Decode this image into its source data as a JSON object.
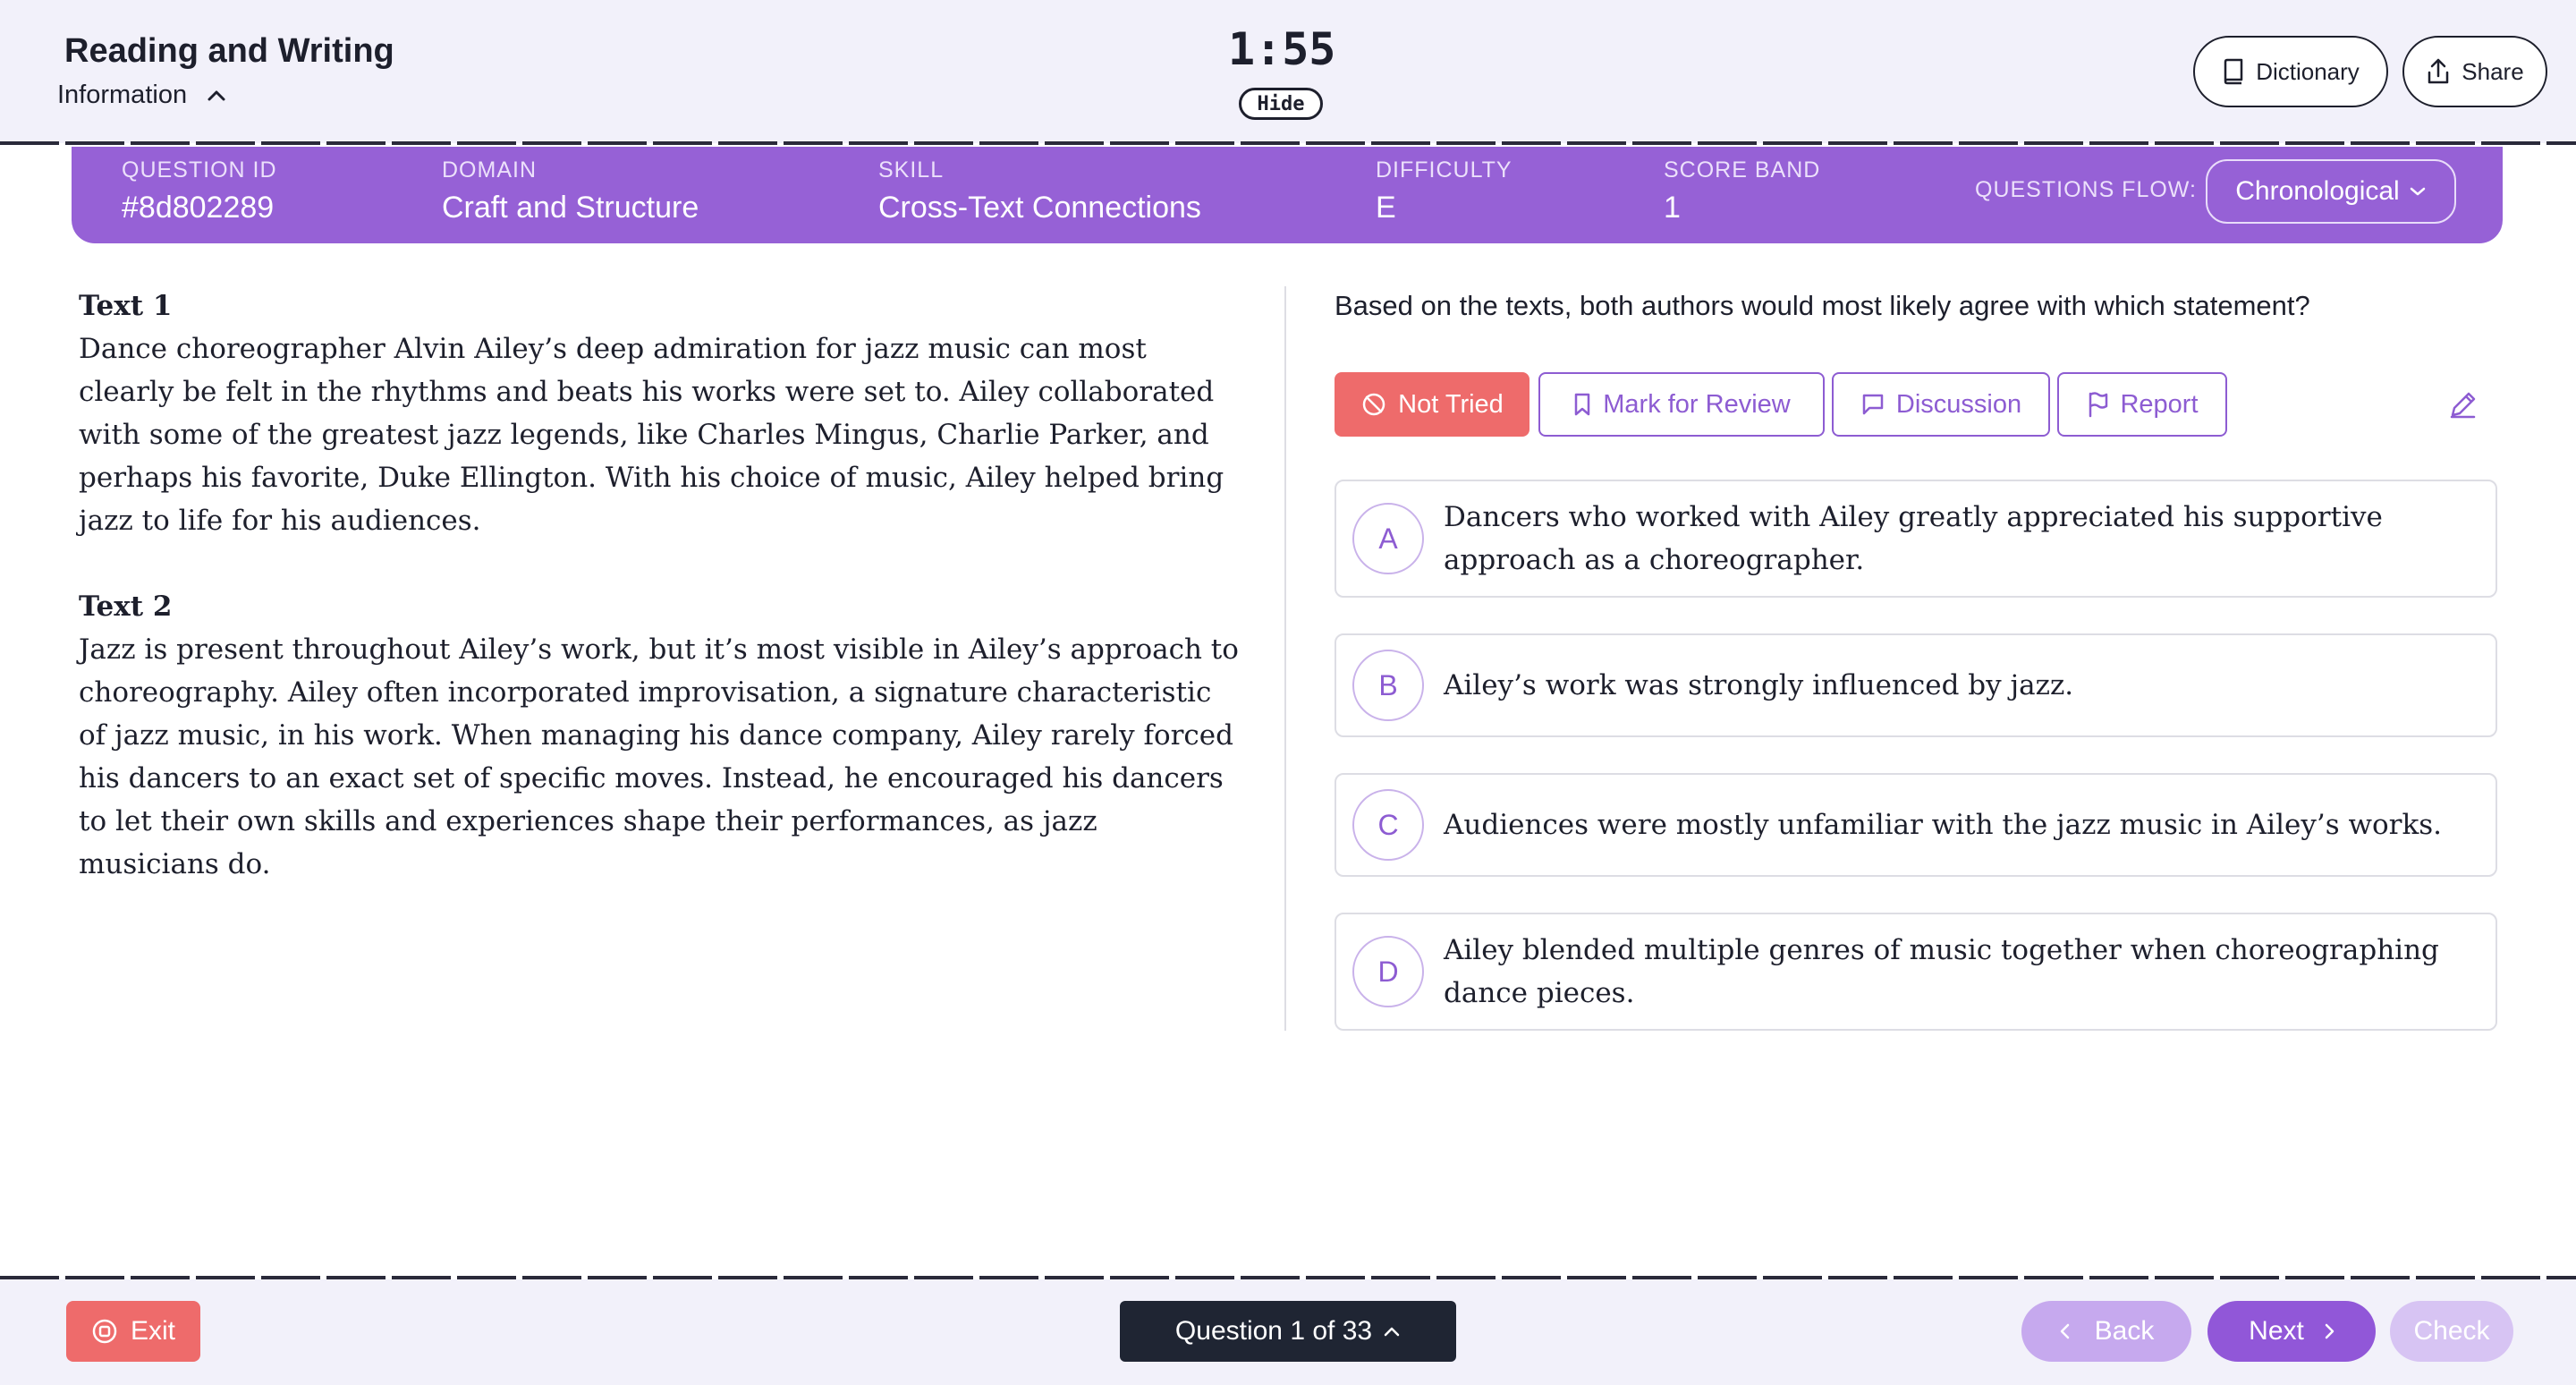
{
  "header": {
    "title": "Reading and Writing",
    "info_label": "Information",
    "timer": "1:55",
    "hide_label": "Hide",
    "dictionary_label": "Dictionary",
    "share_label": "Share"
  },
  "info_bar": {
    "question_id": {
      "label": "QUESTION ID",
      "value": "#8d802289"
    },
    "domain": {
      "label": "DOMAIN",
      "value": "Craft and Structure"
    },
    "skill": {
      "label": "SKILL",
      "value": "Cross-Text Connections"
    },
    "difficulty": {
      "label": "DIFFICULTY",
      "value": "E"
    },
    "score_band": {
      "label": "SCORE BAND",
      "value": "1"
    },
    "questions_flow": {
      "label": "QUESTIONS FLOW:",
      "value": "Chronological"
    }
  },
  "passage": {
    "text1_title": "Text 1",
    "text1_body": "Dance choreographer Alvin Ailey’s deep admiration for jazz music can most clearly be felt in the rhythms and beats his works were set to. Ailey collaborated with some of the greatest jazz legends, like Charles Mingus, Charlie Parker, and perhaps his favorite, Duke Ellington. With his choice of music, Ailey helped bring jazz to life for his audiences.",
    "text2_title": "Text 2",
    "text2_body": "Jazz is present throughout Ailey’s work, but it’s most visible in Ailey’s approach to choreography. Ailey often incorporated improvisation, a signature characteristic of jazz music, in his work. When managing his dance company, Ailey rarely forced his dancers to an exact set of specific moves. Instead, he encouraged his dancers to let their own skills and experiences shape their performances, as jazz musicians do."
  },
  "question": {
    "prompt": "Based on the texts, both authors would most likely agree with which statement?",
    "actions": {
      "not_tried": "Not Tried",
      "mark_for_review": "Mark for Review",
      "discussion": "Discussion",
      "report": "Report"
    },
    "choices": [
      {
        "letter": "A",
        "text": "Dancers who worked with Ailey greatly appreciated his supportive approach as a choreographer."
      },
      {
        "letter": "B",
        "text": "Ailey’s work was strongly influenced by jazz."
      },
      {
        "letter": "C",
        "text": "Audiences were mostly unfamiliar with the jazz music in Ailey’s works."
      },
      {
        "letter": "D",
        "text": "Ailey blended multiple genres of music together when choreographing dance pieces."
      }
    ]
  },
  "footer": {
    "exit_label": "Exit",
    "question_nav": "Question 1 of 33",
    "back_label": "Back",
    "next_label": "Next",
    "check_label": "Check"
  },
  "colors": {
    "accent_purple": "#9661d6",
    "danger_red": "#ee6b6b",
    "dark_navy": "#1f2533",
    "header_bg": "#f2f1fa"
  }
}
